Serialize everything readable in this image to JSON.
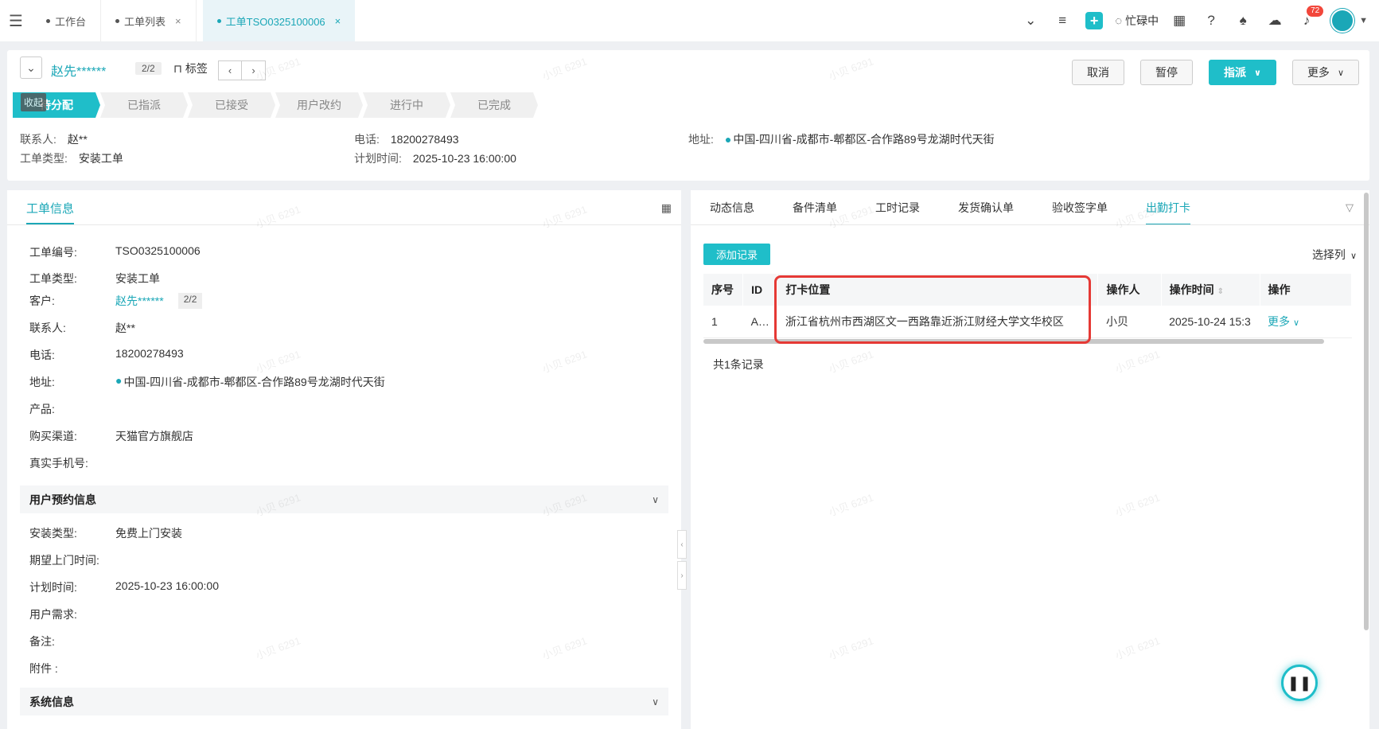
{
  "topbar": {
    "tabs": [
      {
        "label": "工作台"
      },
      {
        "label": "工单列表",
        "close": "×"
      },
      {
        "label": "工单TSO0325100006",
        "close": "×"
      }
    ],
    "status_label": "忙碌中",
    "notification_count": "72"
  },
  "header": {
    "customer_name": "赵先******",
    "count": "2/2",
    "tag_label": "标签",
    "buttons": {
      "cancel": "取消",
      "pause": "暂停",
      "dispatch": "指派",
      "more": "更多"
    },
    "collapse_tip": "收起",
    "steps": [
      "待分配",
      "已指派",
      "已接受",
      "用户改约",
      "进行中",
      "已完成"
    ],
    "contact_label": "联系人:",
    "contact_value": "赵**",
    "phone_label": "电话:",
    "phone_value": "18200278493",
    "address_label": "地址:",
    "address_value": "中国-四川省-成都市-郫都区-合作路89号龙湖时代天街",
    "type_label": "工单类型:",
    "type_value": "安装工单",
    "plan_label": "计划时间:",
    "plan_value": "2025-10-23 16:00:00"
  },
  "left_panel": {
    "tab": "工单信息",
    "fields": [
      {
        "label": "工单编号:",
        "value": "TSO0325100006"
      },
      {
        "label": "工单类型:",
        "value": "安装工单"
      },
      {
        "label": "客户:",
        "value": "赵先******",
        "tag": "2/2"
      },
      {
        "label": "联系人:",
        "value": "赵**"
      },
      {
        "label": "电话:",
        "value": "18200278493"
      },
      {
        "label": "地址:",
        "value": "中国-四川省-成都市-郫都区-合作路89号龙湖时代天街"
      },
      {
        "label": "产品:",
        "value": ""
      },
      {
        "label": "购买渠道:",
        "value": "天猫官方旗舰店"
      },
      {
        "label": "真实手机号:",
        "value": ""
      }
    ],
    "section1": "用户预约信息",
    "fields2": [
      {
        "label": "安装类型:",
        "value": "免费上门安装"
      },
      {
        "label": "期望上门时间:",
        "value": ""
      },
      {
        "label": "计划时间:",
        "value": "2025-10-23 16:00:00"
      },
      {
        "label": "用户需求:",
        "value": ""
      },
      {
        "label": "备注:",
        "value": ""
      },
      {
        "label": "附件 :",
        "value": ""
      }
    ],
    "section2": "系统信息"
  },
  "right_panel": {
    "tabs": [
      "动态信息",
      "备件清单",
      "工时记录",
      "发货确认单",
      "验收签字单",
      "出勤打卡"
    ],
    "add_button": "添加记录",
    "select_columns": "选择列",
    "columns": [
      "序号",
      "ID",
      "打卡位置",
      "操作人",
      "操作时间",
      "操作"
    ],
    "rows": [
      {
        "index": "1",
        "id": "A…",
        "location": "浙江省杭州市西湖区文一西路靠近浙江财经大学文华校区",
        "operator": "小贝",
        "time": "2025-10-24 15:3",
        "action": "更多"
      }
    ],
    "total": "共1条记录"
  },
  "watermark": "小贝 6291",
  "colors": {
    "accent": "#1fbec9",
    "highlight": "#e53935"
  }
}
